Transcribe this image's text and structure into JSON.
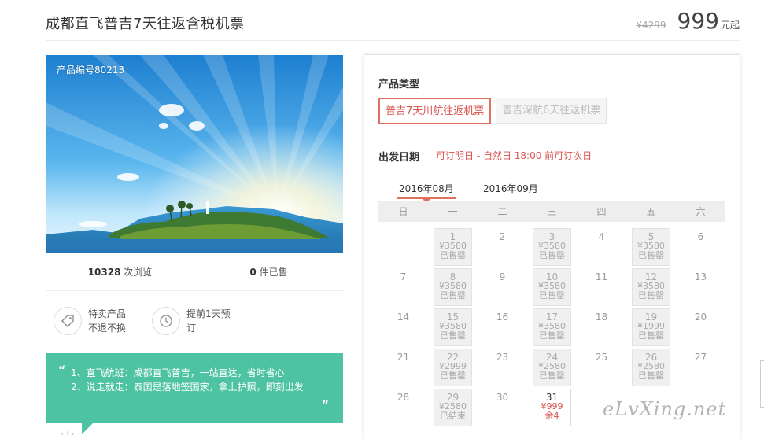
{
  "header": {
    "title": "成都直飞普吉7天往返含税机票",
    "old_price": "¥4299",
    "price": "999",
    "price_unit": "元起"
  },
  "hero": {
    "product_no": "产品编号80213"
  },
  "stats": {
    "views_count": "10328",
    "views_label": " 次浏览",
    "sold_count": "0",
    "sold_label": " 件已售"
  },
  "features": [
    {
      "icon": "tag-icon",
      "line1": "特卖产品",
      "line2": "不退不换"
    },
    {
      "icon": "clock-icon",
      "line1": "提前1天预",
      "line2": "订"
    }
  ],
  "quote": {
    "open": "“",
    "close": "”",
    "lines": [
      "1、直飞航班：成都直飞普吉，一站直达，省时省心",
      "2、说走就走：泰国是落地签国家，拿上护照，即刻出发"
    ]
  },
  "panel": {
    "type_label": "产品类型",
    "types": [
      {
        "label": "普吉7天川航往返机票",
        "selected": true
      },
      {
        "label": "普吉深航6天往返机票",
        "selected": false
      }
    ],
    "date_label": "出发日期",
    "date_note": "可订明日 - 自然日 18:00 前可订次日",
    "months": [
      {
        "label": "2016年08月",
        "active": true
      },
      {
        "label": "2016年09月",
        "active": false
      }
    ],
    "weekdays": [
      "日",
      "一",
      "二",
      "三",
      "四",
      "五",
      "六"
    ]
  },
  "calendar": [
    [
      {
        "day": ""
      },
      {
        "day": "1",
        "price": "¥3580",
        "state": "已售罄"
      },
      {
        "day": "2"
      },
      {
        "day": "3",
        "price": "¥3580",
        "state": "已售罄"
      },
      {
        "day": "4"
      },
      {
        "day": "5",
        "price": "¥3580",
        "state": "已售罄"
      },
      {
        "day": "6"
      }
    ],
    [
      {
        "day": "7"
      },
      {
        "day": "8",
        "price": "¥3580",
        "state": "已售罄"
      },
      {
        "day": "9"
      },
      {
        "day": "10",
        "price": "¥3580",
        "state": "已售罄"
      },
      {
        "day": "11"
      },
      {
        "day": "12",
        "price": "¥3580",
        "state": "已售罄"
      },
      {
        "day": "13"
      }
    ],
    [
      {
        "day": "14"
      },
      {
        "day": "15",
        "price": "¥3580",
        "state": "已售罄"
      },
      {
        "day": "16"
      },
      {
        "day": "17",
        "price": "¥3580",
        "state": "已售罄"
      },
      {
        "day": "18"
      },
      {
        "day": "19",
        "price": "¥1999",
        "state": "已售罄"
      },
      {
        "day": "20"
      }
    ],
    [
      {
        "day": "21"
      },
      {
        "day": "22",
        "price": "¥2999",
        "state": "已售罄"
      },
      {
        "day": "23"
      },
      {
        "day": "24",
        "price": "¥2580",
        "state": "已售罄"
      },
      {
        "day": "25"
      },
      {
        "day": "26",
        "price": "¥2580",
        "state": "已售罄"
      },
      {
        "day": "27"
      }
    ],
    [
      {
        "day": "28"
      },
      {
        "day": "29",
        "price": "¥2580",
        "state": "已结束"
      },
      {
        "day": "30"
      },
      {
        "day": "31",
        "price": "¥999",
        "state": "余4",
        "available": true
      },
      {
        "day": ""
      },
      {
        "day": ""
      },
      {
        "day": ""
      }
    ]
  ],
  "watermark": "eLvXing.net",
  "colors": {
    "accent": "#d9534f",
    "teal": "#4dc3a1",
    "sold_bg": "#f0f0f0"
  }
}
